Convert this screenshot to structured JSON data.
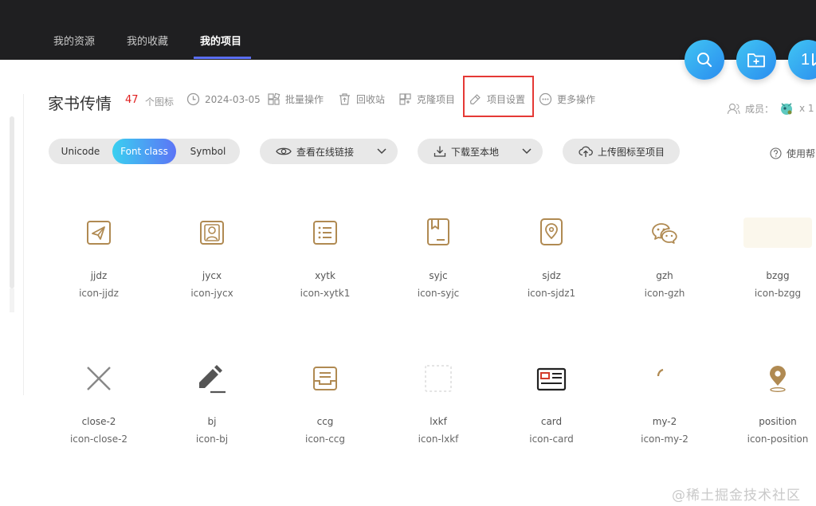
{
  "nav": {
    "tabs": [
      {
        "label": "我的资源"
      },
      {
        "label": "我的收藏"
      },
      {
        "label": "我的项目"
      }
    ]
  },
  "fab": {
    "third_label": "1"
  },
  "project": {
    "title": "家书传情",
    "icon_count": "47",
    "count_label": "个图标",
    "date": "2024-03-05",
    "actions": {
      "batch": "批量操作",
      "recycle": "回收站",
      "clone": "克隆项目",
      "settings": "项目设置",
      "more": "更多操作"
    },
    "members_label": "成员：",
    "members_count": "x 1"
  },
  "formats": {
    "tabs": [
      {
        "label": "Unicode"
      },
      {
        "label": "Font class"
      },
      {
        "label": "Symbol"
      }
    ],
    "active": "Font class"
  },
  "toolbar": {
    "view_link": "查看在线链接",
    "download": "下载至本地",
    "upload": "上传图标至项目",
    "help": "使用帮"
  },
  "colors": {
    "icon_gold": "#b08a52",
    "accent_blue": "#5b6ff5",
    "highlight_red": "#e53935"
  },
  "icons": [
    {
      "name": "jjdz",
      "class": "icon-jjdz",
      "glyph": "paper-plane-icon"
    },
    {
      "name": "jycx",
      "class": "icon-jycx",
      "glyph": "id-card-icon"
    },
    {
      "name": "xytk",
      "class": "icon-xytk1",
      "glyph": "list-icon"
    },
    {
      "name": "syjc",
      "class": "icon-syjc",
      "glyph": "bookmark-book-icon"
    },
    {
      "name": "sjdz",
      "class": "icon-sjdz1",
      "glyph": "location-card-icon"
    },
    {
      "name": "gzh",
      "class": "icon-gzh",
      "glyph": "wechat-icon"
    },
    {
      "name": "bzgg",
      "class": "icon-bzgg",
      "glyph": "blank-icon"
    },
    {
      "name": "close-2",
      "class": "icon-close-2",
      "glyph": "close-icon"
    },
    {
      "name": "bj",
      "class": "icon-bj",
      "glyph": "pencil-icon"
    },
    {
      "name": "ccg",
      "class": "icon-ccg",
      "glyph": "inbox-icon"
    },
    {
      "name": "lxkf",
      "class": "icon-lxkf",
      "glyph": "dotted-square-icon"
    },
    {
      "name": "card",
      "class": "icon-card",
      "glyph": "card-icon"
    },
    {
      "name": "my-2",
      "class": "icon-my-2",
      "glyph": "partial-arc-icon"
    },
    {
      "name": "position",
      "class": "icon-position",
      "glyph": "pin-icon"
    }
  ],
  "watermark": "@稀土掘金技术社区"
}
